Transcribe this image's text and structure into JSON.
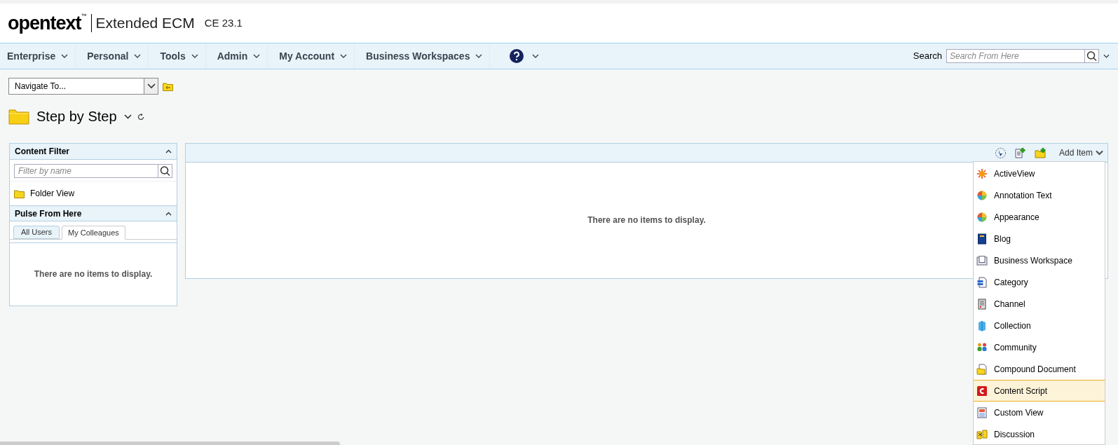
{
  "header": {
    "logo": "opentext",
    "trademark": "™",
    "product": "Extended ECM",
    "version": "CE 23.1"
  },
  "nav": {
    "menus": [
      {
        "label": "Enterprise"
      },
      {
        "label": "Personal"
      },
      {
        "label": "Tools"
      },
      {
        "label": "Admin"
      },
      {
        "label": "My Account"
      },
      {
        "label": "Business Workspaces"
      }
    ],
    "search_label": "Search",
    "search": {
      "placeholder": "Search From Here"
    }
  },
  "navigate": {
    "value": "Navigate To..."
  },
  "page_title": "Step by Step",
  "content_filter": {
    "title": "Content Filter",
    "filter": {
      "placeholder": "Filter by name"
    },
    "items": [
      {
        "label": "Folder View"
      }
    ]
  },
  "pulse": {
    "title": "Pulse From Here",
    "tabs": [
      {
        "label": "All Users",
        "selected": false
      },
      {
        "label": "My Colleagues",
        "selected": true
      }
    ],
    "empty": "There are no items to display."
  },
  "main": {
    "empty": "There are no items to display.",
    "add_item": "Add Item"
  },
  "add_menu": [
    {
      "label": "ActiveView",
      "kind": "sun",
      "selected": false
    },
    {
      "label": "Annotation Text",
      "kind": "ball",
      "selected": false
    },
    {
      "label": "Appearance",
      "kind": "ball",
      "selected": false
    },
    {
      "label": "Blog",
      "kind": "book",
      "selected": false
    },
    {
      "label": "Business Workspace",
      "kind": "workspace",
      "selected": false
    },
    {
      "label": "Category",
      "kind": "category",
      "selected": false
    },
    {
      "label": "Channel",
      "kind": "channel",
      "selected": false
    },
    {
      "label": "Collection",
      "kind": "collection",
      "selected": false
    },
    {
      "label": "Community",
      "kind": "people",
      "selected": false
    },
    {
      "label": "Compound Document",
      "kind": "compound",
      "selected": false
    },
    {
      "label": "Content Script",
      "kind": "script",
      "selected": true
    },
    {
      "label": "Custom View",
      "kind": "customview",
      "selected": false
    },
    {
      "label": "Discussion",
      "kind": "discussion",
      "selected": false
    }
  ]
}
